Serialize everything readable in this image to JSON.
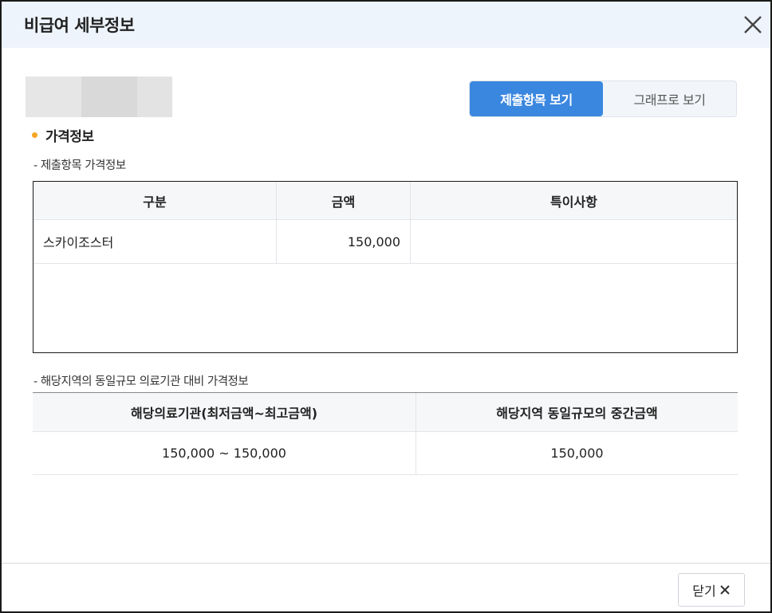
{
  "dialog": {
    "title": "비급여 세부정보",
    "close_icon": "close-icon"
  },
  "view_toggle": {
    "active_label": "제출항목 보기",
    "inactive_label": "그래프로 보기"
  },
  "section": {
    "title": "가격정보"
  },
  "submitted": {
    "subtitle": "- 제출항목 가격정보",
    "headers": [
      "구분",
      "금액",
      "특이사항"
    ],
    "rows": [
      {
        "category": "스카이조스터",
        "amount": "150,000",
        "note": ""
      }
    ]
  },
  "regional": {
    "subtitle": "- 해당지역의 동일규모 의료기관 대비 가격정보",
    "headers": [
      "해당의료기관(최저금액~최고금액)",
      "해당지역 동일규모의 중간금액"
    ],
    "row": {
      "range": "150,000 ~ 150,000",
      "median": "150,000"
    }
  },
  "footer": {
    "close_label": "닫기"
  },
  "colors": {
    "header_bg": "#eef4fc",
    "accent": "#3a87e0",
    "bullet": "#f5a623"
  }
}
